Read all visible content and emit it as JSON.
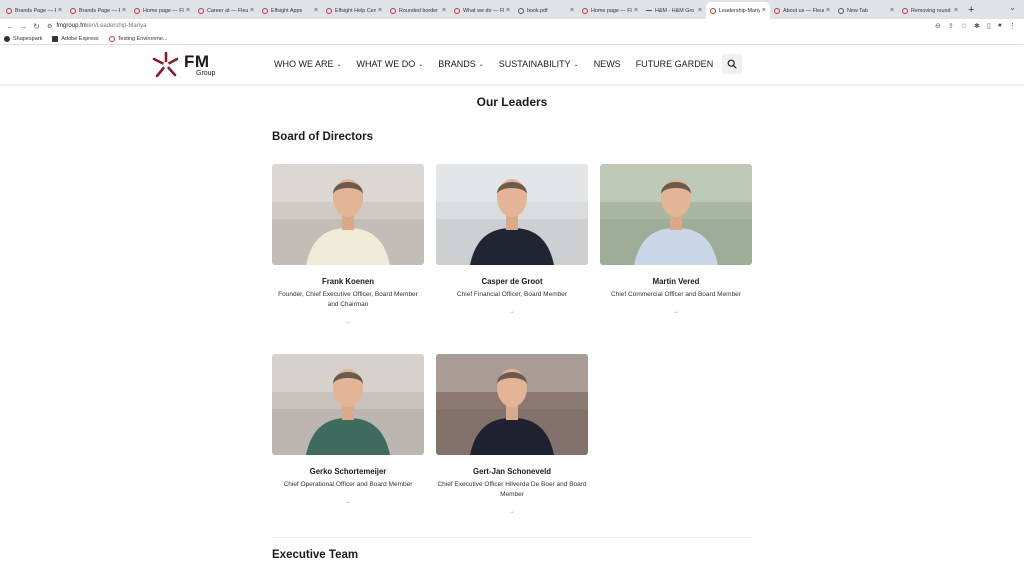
{
  "browser": {
    "tabs": [
      {
        "label": "Brands Page — F",
        "icon": "red-ring"
      },
      {
        "label": "Brands Page — F",
        "icon": "red-ring"
      },
      {
        "label": "Home page — Fle",
        "icon": "star-logo"
      },
      {
        "label": "Career at — Fleur",
        "icon": "star-logo"
      },
      {
        "label": "Elfsight Apps",
        "icon": "red-ring"
      },
      {
        "label": "Elfsight Help Cen",
        "icon": "red-ring"
      },
      {
        "label": "Rounded border",
        "icon": "red-ring"
      },
      {
        "label": "What we do — Fle",
        "icon": "star-logo"
      },
      {
        "label": "book.pdf",
        "icon": "globe"
      },
      {
        "label": "Home page — Fle",
        "icon": "star-logo"
      },
      {
        "label": "H&M - H&M Gro",
        "icon": "dash"
      },
      {
        "label": "Leadership-Mariy",
        "icon": "star-logo",
        "active": true
      },
      {
        "label": "About us — Fleur",
        "icon": "star-logo"
      },
      {
        "label": "New Tab",
        "icon": "globe"
      },
      {
        "label": "Removing round",
        "icon": "red-ring"
      }
    ],
    "url_host": "fmgroup.fm",
    "url_path": "/en/Leadership-Mariya",
    "bookmarks": [
      {
        "label": "Shapespark",
        "icon": "shapespark-icon"
      },
      {
        "label": "Adobe Express",
        "icon": "adobe-icon"
      },
      {
        "label": "Testing Environme...",
        "icon": "star-logo"
      }
    ]
  },
  "site": {
    "logo": {
      "text": "FM",
      "subtext": "Group",
      "color": "#8b1a2b"
    },
    "nav": [
      {
        "label": "WHO WE ARE",
        "dropdown": true
      },
      {
        "label": "WHAT WE DO",
        "dropdown": true
      },
      {
        "label": "BRANDS",
        "dropdown": true
      },
      {
        "label": "SUSTAINABILITY",
        "dropdown": true
      },
      {
        "label": "NEWS",
        "dropdown": false
      },
      {
        "label": "FUTURE GARDEN",
        "dropdown": false
      }
    ]
  },
  "page": {
    "title": "Our Leaders",
    "board_heading": "Board of Directors",
    "exec_heading": "Executive Team",
    "arrow": "→",
    "board": [
      {
        "name": "Frank Koenen",
        "role": "Founder, Chief Executive Officer, Board Member and Chairman",
        "photo_bg": "#cfcac3",
        "shirt": "#f0ead8"
      },
      {
        "name": "Casper de Groot",
        "role": "Chief Financial Officer, Board Member",
        "photo_bg": "#d9dde0",
        "shirt": "#1f2533"
      },
      {
        "name": "Martin Vered",
        "role": "Chief Commercial Officer and Board Member",
        "photo_bg": "#a9b7a1",
        "shirt": "#c8d6e8"
      },
      {
        "name": "Gerko Schortemeijer",
        "role": "Chief Operational Officer and Board Member",
        "photo_bg": "#c9c2bc",
        "shirt": "#3f6b5e"
      },
      {
        "name": "Gert-Jan Schoneveld",
        "role": "Chief Executive Officer Hilverda De Boer and Board Member",
        "photo_bg": "#8c7a72",
        "shirt": "#1e2230"
      }
    ]
  }
}
